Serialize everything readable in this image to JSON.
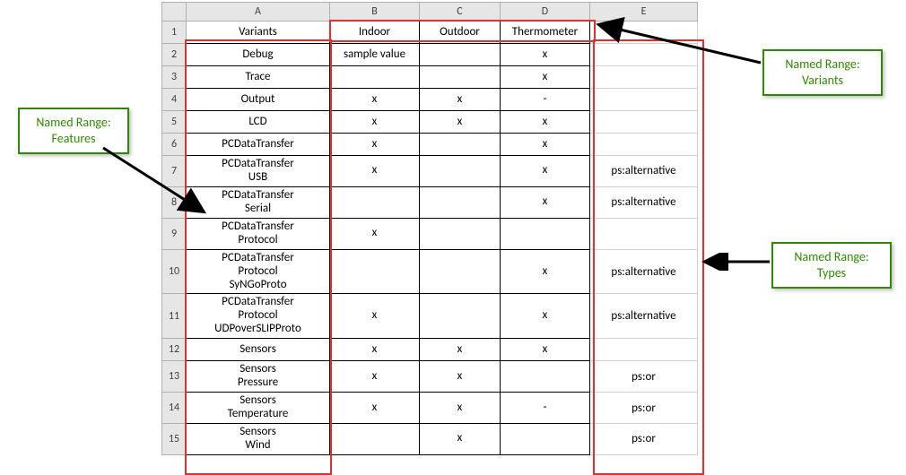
{
  "columns": [
    "A",
    "B",
    "C",
    "D",
    "E"
  ],
  "header": {
    "A": "Variants",
    "B": "Indoor",
    "C": "Outdoor",
    "D": "Thermometer",
    "E": ""
  },
  "rows": [
    {
      "n": "2",
      "A": "Debug",
      "B": "sample value",
      "C": "",
      "D": "x",
      "E": ""
    },
    {
      "n": "3",
      "A": "Trace",
      "B": "",
      "C": "",
      "D": "x",
      "E": ""
    },
    {
      "n": "4",
      "A": "Output",
      "B": "x",
      "C": "x",
      "D": "-",
      "E": ""
    },
    {
      "n": "5",
      "A": "LCD",
      "B": "x",
      "C": "x",
      "D": "x",
      "E": ""
    },
    {
      "n": "6",
      "A": "PCDataTransfer",
      "B": "x",
      "C": "",
      "D": "x",
      "E": ""
    },
    {
      "n": "7",
      "A": "PCDataTransfer\nUSB",
      "B": "x",
      "C": "",
      "D": "x",
      "E": "ps:alternative"
    },
    {
      "n": "8",
      "A": "PCDataTransfer\nSerial",
      "B": "",
      "C": "",
      "D": "x",
      "E": "ps:alternative"
    },
    {
      "n": "9",
      "A": "PCDataTransfer\nProtocol",
      "B": "x",
      "C": "",
      "D": "",
      "E": ""
    },
    {
      "n": "10",
      "A": "PCDataTransfer\nProtocol\nSyNGoProto",
      "B": "",
      "C": "",
      "D": "x",
      "E": "ps:alternative"
    },
    {
      "n": "11",
      "A": "PCDataTransfer\nProtocol\nUDPoverSLIPProto",
      "B": "x",
      "C": "",
      "D": "x",
      "E": "ps:alternative"
    },
    {
      "n": "12",
      "A": "Sensors",
      "B": "x",
      "C": "x",
      "D": "x",
      "E": ""
    },
    {
      "n": "13",
      "A": "Sensors\nPressure",
      "B": "x",
      "C": "x",
      "D": "",
      "E": "ps:or"
    },
    {
      "n": "14",
      "A": "Sensors\nTemperature",
      "B": "x",
      "C": "x",
      "D": "-",
      "E": "ps:or"
    },
    {
      "n": "15",
      "A": "Sensors\nWind",
      "B": "",
      "C": "x",
      "D": "",
      "E": "ps:or"
    }
  ],
  "callouts": {
    "features": {
      "l1": "Named Range:",
      "l2": "Features"
    },
    "variants": {
      "l1": "Named Range:",
      "l2": "Variants"
    },
    "types": {
      "l1": "Named Range:",
      "l2": "Types"
    }
  }
}
